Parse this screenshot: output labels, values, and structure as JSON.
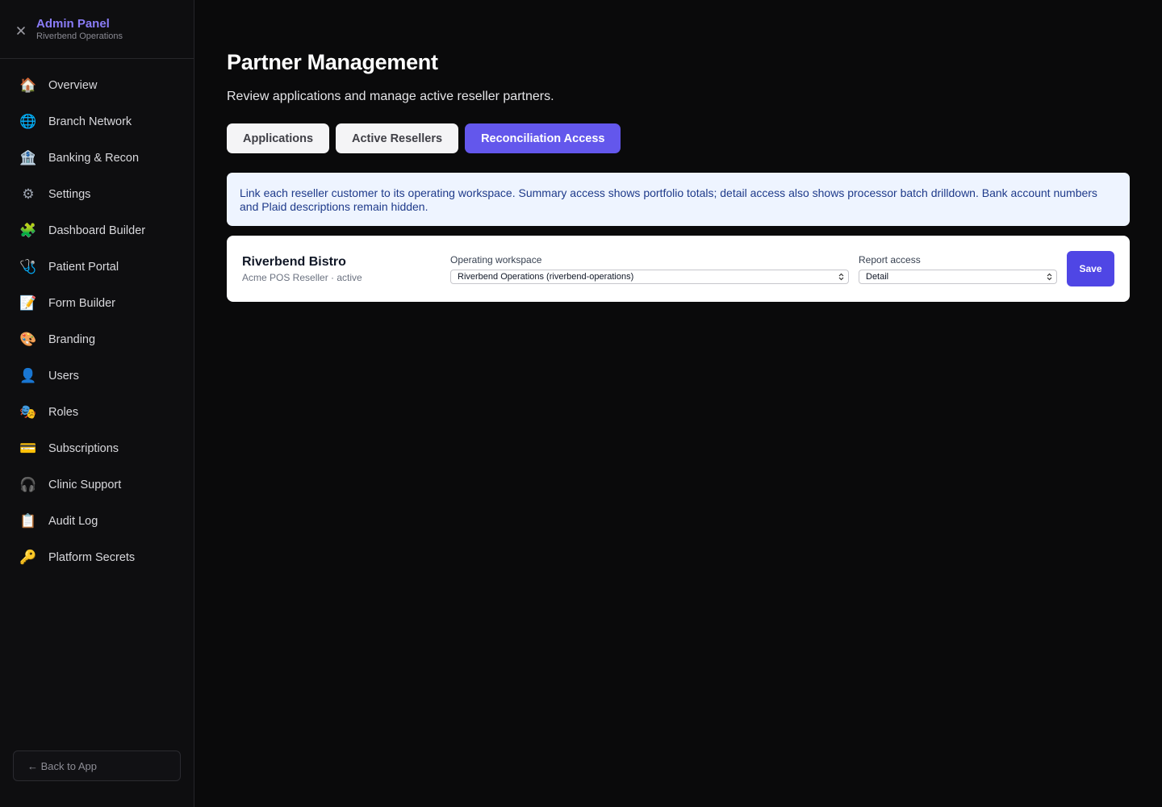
{
  "sidebar": {
    "title": "Admin Panel",
    "subtitle": "Riverbend Operations",
    "items": [
      {
        "label": "Overview",
        "icon": "house-icon",
        "glyph": "🏠"
      },
      {
        "label": "Branch Network",
        "icon": "globe-icon",
        "glyph": "🌐"
      },
      {
        "label": "Banking & Recon",
        "icon": "bank-icon",
        "glyph": "🏦"
      },
      {
        "label": "Settings",
        "icon": "gear-icon",
        "glyph": "⚙"
      },
      {
        "label": "Dashboard Builder",
        "icon": "puzzle-icon",
        "glyph": "🧩"
      },
      {
        "label": "Patient Portal",
        "icon": "stethoscope-icon",
        "glyph": "🩺"
      },
      {
        "label": "Form Builder",
        "icon": "memo-icon",
        "glyph": "📝"
      },
      {
        "label": "Branding",
        "icon": "palette-icon",
        "glyph": "🎨"
      },
      {
        "label": "Users",
        "icon": "user-icon",
        "glyph": "👤"
      },
      {
        "label": "Roles",
        "icon": "masks-icon",
        "glyph": "🎭"
      },
      {
        "label": "Subscriptions",
        "icon": "credit-card-icon",
        "glyph": "💳"
      },
      {
        "label": "Clinic Support",
        "icon": "headphones-icon",
        "glyph": "🎧"
      },
      {
        "label": "Audit Log",
        "icon": "clipboard-icon",
        "glyph": "📋"
      },
      {
        "label": "Platform Secrets",
        "icon": "key-icon",
        "glyph": "🔑"
      }
    ],
    "back_label": "← Back to App"
  },
  "main": {
    "title": "Partner Management",
    "subtitle": "Review applications and manage active reseller partners.",
    "tabs": [
      {
        "label": "Applications"
      },
      {
        "label": "Active Resellers"
      },
      {
        "label": "Reconciliation Access"
      }
    ],
    "info_text": "Link each reseller customer to its operating workspace. Summary access shows portfolio totals; detail access also shows processor batch drilldown. Bank account numbers and Plaid descriptions remain hidden.",
    "row": {
      "customer_name": "Riverbend Bistro",
      "customer_meta": "Acme POS Reseller · active",
      "workspace_label": "Operating workspace",
      "workspace_value": "Riverbend Operations (riverbend-operations)",
      "access_label": "Report access",
      "access_value": "Detail",
      "save_label": "Save"
    }
  },
  "colors": {
    "accent": "#6357ec",
    "save": "#4f46e5",
    "brand_title": "#8a7cf7",
    "info_bg": "#eef4ff",
    "info_text": "#1e3a8a"
  }
}
